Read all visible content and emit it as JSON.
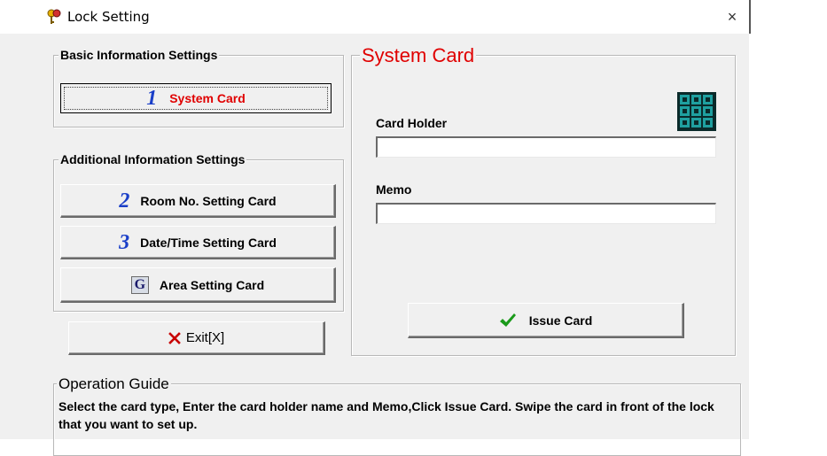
{
  "window": {
    "title": "Lock Setting",
    "close_glyph": "×",
    "icon": "keys-icon"
  },
  "basic": {
    "label": "Basic Information Settings",
    "system_card": {
      "number": "1",
      "label": "System Card"
    }
  },
  "additional": {
    "label": "Additional Information Settings",
    "room": {
      "number": "2",
      "label": "Room No. Setting Card"
    },
    "datetime": {
      "number": "3",
      "label": "Date/Time Setting Card"
    },
    "area": {
      "badge": "G",
      "label": "Area Setting Card"
    }
  },
  "exit": {
    "label": "Exit[X]"
  },
  "system_card_panel": {
    "title": "System Card",
    "card_holder_label": "Card Holder",
    "card_holder_value": "",
    "memo_label": "Memo",
    "memo_value": "",
    "issue_label": "Issue Card",
    "keypad_icon": "keypad-icon"
  },
  "guide": {
    "label": "Operation Guide",
    "text": "Select the card type, Enter the card holder name and Memo,Click Issue Card. Swipe the card in front of the  lock that you want to set up."
  },
  "colors": {
    "accent_red": "#e00000",
    "number_blue": "#1a3fc8",
    "check_green": "#1a9a1a",
    "exit_red": "#c80000"
  }
}
